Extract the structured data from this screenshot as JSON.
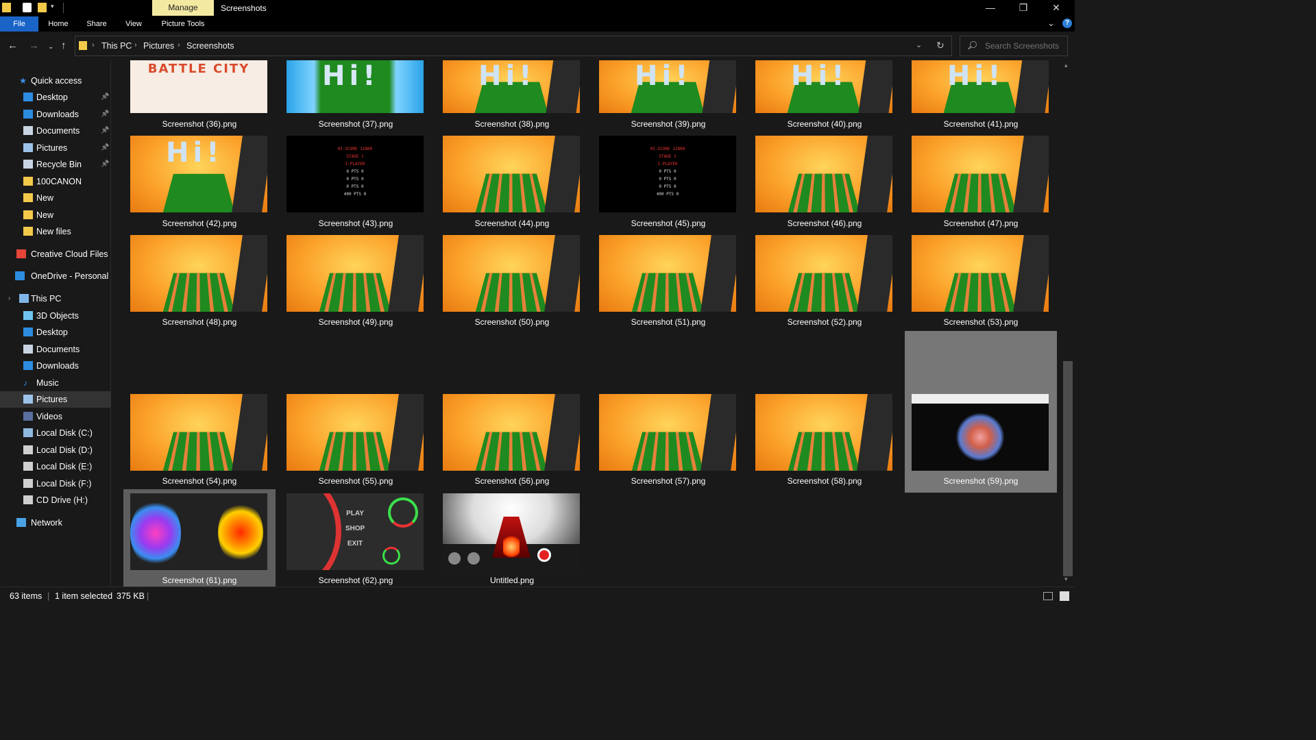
{
  "titlebar": {
    "context_tab": "Manage",
    "window_title": "Screenshots",
    "minimize_icon": "minimize-icon",
    "maximize_icon": "restore-icon",
    "close_icon": "close-icon"
  },
  "ribbon": {
    "tabs": [
      "File",
      "Home",
      "Share",
      "View",
      "Picture Tools"
    ],
    "help_label": "?"
  },
  "address": {
    "crumbs": [
      "This PC",
      "Pictures",
      "Screenshots"
    ],
    "search_placeholder": "Search Screenshots"
  },
  "sidebar": {
    "items": [
      {
        "label": "Quick access",
        "icon": "star-icon",
        "pinned": false
      },
      {
        "label": "Desktop",
        "icon": "desktop-icon",
        "pinned": true
      },
      {
        "label": "Downloads",
        "icon": "download-icon",
        "pinned": true
      },
      {
        "label": "Documents",
        "icon": "document-icon",
        "pinned": true
      },
      {
        "label": "Pictures",
        "icon": "pictures-icon",
        "pinned": true
      },
      {
        "label": "Recycle Bin",
        "icon": "recycle-bin-icon",
        "pinned": true
      },
      {
        "label": "100CANON",
        "icon": "folder-icon",
        "pinned": false
      },
      {
        "label": "New",
        "icon": "folder-icon",
        "pinned": false
      },
      {
        "label": "New",
        "icon": "folder-icon",
        "pinned": false
      },
      {
        "label": "New files",
        "icon": "folder-icon",
        "pinned": false
      },
      {
        "label": "Creative Cloud Files",
        "icon": "creative-cloud-icon",
        "pinned": false
      },
      {
        "label": "OneDrive - Personal",
        "icon": "cloud-icon",
        "pinned": false
      },
      {
        "label": "This PC",
        "icon": "computer-icon",
        "pinned": false
      },
      {
        "label": "3D Objects",
        "icon": "cube-icon",
        "pinned": false
      },
      {
        "label": "Desktop",
        "icon": "desktop-icon",
        "pinned": false
      },
      {
        "label": "Documents",
        "icon": "document-icon",
        "pinned": false
      },
      {
        "label": "Downloads",
        "icon": "download-icon",
        "pinned": false
      },
      {
        "label": "Music",
        "icon": "music-icon",
        "pinned": false
      },
      {
        "label": "Pictures",
        "icon": "pictures-icon",
        "pinned": false
      },
      {
        "label": "Videos",
        "icon": "video-icon",
        "pinned": false
      },
      {
        "label": "Local Disk (C:)",
        "icon": "drive-c-icon",
        "pinned": false
      },
      {
        "label": "Local Disk (D:)",
        "icon": "drive-icon",
        "pinned": false
      },
      {
        "label": "Local Disk (E:)",
        "icon": "drive-icon",
        "pinned": false
      },
      {
        "label": "Local Disk (F:)",
        "icon": "drive-icon",
        "pinned": false
      },
      {
        "label": "CD Drive (H:)",
        "icon": "cd-drive-icon",
        "pinned": false
      },
      {
        "label": "Network",
        "icon": "network-icon",
        "pinned": false
      }
    ],
    "selected_label": "Pictures"
  },
  "files": [
    {
      "name": "Screenshot (36).png",
      "kind": "battle"
    },
    {
      "name": "Screenshot (37).png",
      "kind": "water"
    },
    {
      "name": "Screenshot (38).png",
      "kind": "hi"
    },
    {
      "name": "Screenshot (39).png",
      "kind": "hi"
    },
    {
      "name": "Screenshot (40).png",
      "kind": "hi"
    },
    {
      "name": "Screenshot (41).png",
      "kind": "hi"
    },
    {
      "name": "Screenshot (42).png",
      "kind": "hi"
    },
    {
      "name": "Screenshot (43).png",
      "kind": "score"
    },
    {
      "name": "Screenshot (44).png",
      "kind": "game"
    },
    {
      "name": "Screenshot (45).png",
      "kind": "score"
    },
    {
      "name": "Screenshot (46).png",
      "kind": "game"
    },
    {
      "name": "Screenshot (47).png",
      "kind": "game"
    },
    {
      "name": "Screenshot (48).png",
      "kind": "game"
    },
    {
      "name": "Screenshot (49).png",
      "kind": "game"
    },
    {
      "name": "Screenshot (50).png",
      "kind": "game"
    },
    {
      "name": "Screenshot (51).png",
      "kind": "game"
    },
    {
      "name": "Screenshot (52).png",
      "kind": "game"
    },
    {
      "name": "Screenshot (53).png",
      "kind": "game"
    },
    {
      "name": "Screenshot (54).png",
      "kind": "game"
    },
    {
      "name": "Screenshot (55).png",
      "kind": "game"
    },
    {
      "name": "Screenshot (56).png",
      "kind": "game"
    },
    {
      "name": "Screenshot (57).png",
      "kind": "game"
    },
    {
      "name": "Screenshot (58).png",
      "kind": "game"
    },
    {
      "name": "Screenshot (59).png",
      "kind": "burst"
    },
    {
      "name": "Screenshot (61).png",
      "kind": "sun"
    },
    {
      "name": "Screenshot (62).png",
      "kind": "menu"
    },
    {
      "name": "Untitled.png",
      "kind": "untitled"
    }
  ],
  "thumb_text": {
    "hi": "Hi!",
    "battle_logo": "BATTLE CITY",
    "score_lines": [
      "HI-SCORE   12800",
      "STAGE 1",
      "I-PLAYER",
      "0  PTS  0",
      "0  PTS  0",
      "0  PTS  0",
      "400 PTS 0"
    ],
    "menu_items": [
      "PLAY",
      "SHOP",
      "EXIT"
    ]
  },
  "selection": {
    "hover_file": "Screenshot (59).png",
    "selected_file": "Screenshot (61).png"
  },
  "status": {
    "item_count": "63 items",
    "selected": "1 item selected",
    "size": "375 KB"
  },
  "colors": {
    "accent": "#1a64c8",
    "context_tab": "#f4e9a1",
    "folder": "#f3c94a",
    "selection": "#5e5e5e",
    "hover": "#777777"
  }
}
